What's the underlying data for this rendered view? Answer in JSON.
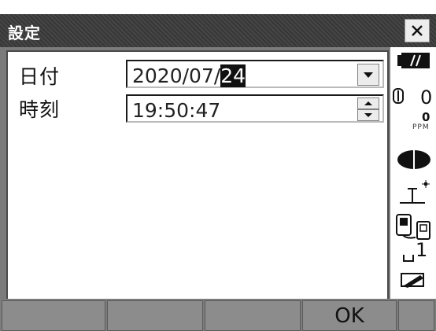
{
  "window": {
    "title": "設定",
    "close_label": "×"
  },
  "form": {
    "date_label": "日付",
    "date_value_prefix": "2020/07/",
    "date_value_selected": "24",
    "time_label": "時刻",
    "time_value": "19:50:47"
  },
  "status": {
    "battery_icon": "battery-icon",
    "tilt_value": "0",
    "ppm_value": "0",
    "ppm_label": "PPM",
    "target_icon": "prism-target-icon",
    "laser_icon": "laser-plummet-icon",
    "comm_icon": "communication-icon",
    "instrument_height": "1",
    "input_mode_icon": "input-mode-icon"
  },
  "softkeys": [
    "",
    "",
    "",
    "OK",
    ""
  ],
  "colors": {
    "title_bg": "#3a3a3a",
    "frame": "#7b7b7b",
    "softkey": "#8c8c8c"
  }
}
